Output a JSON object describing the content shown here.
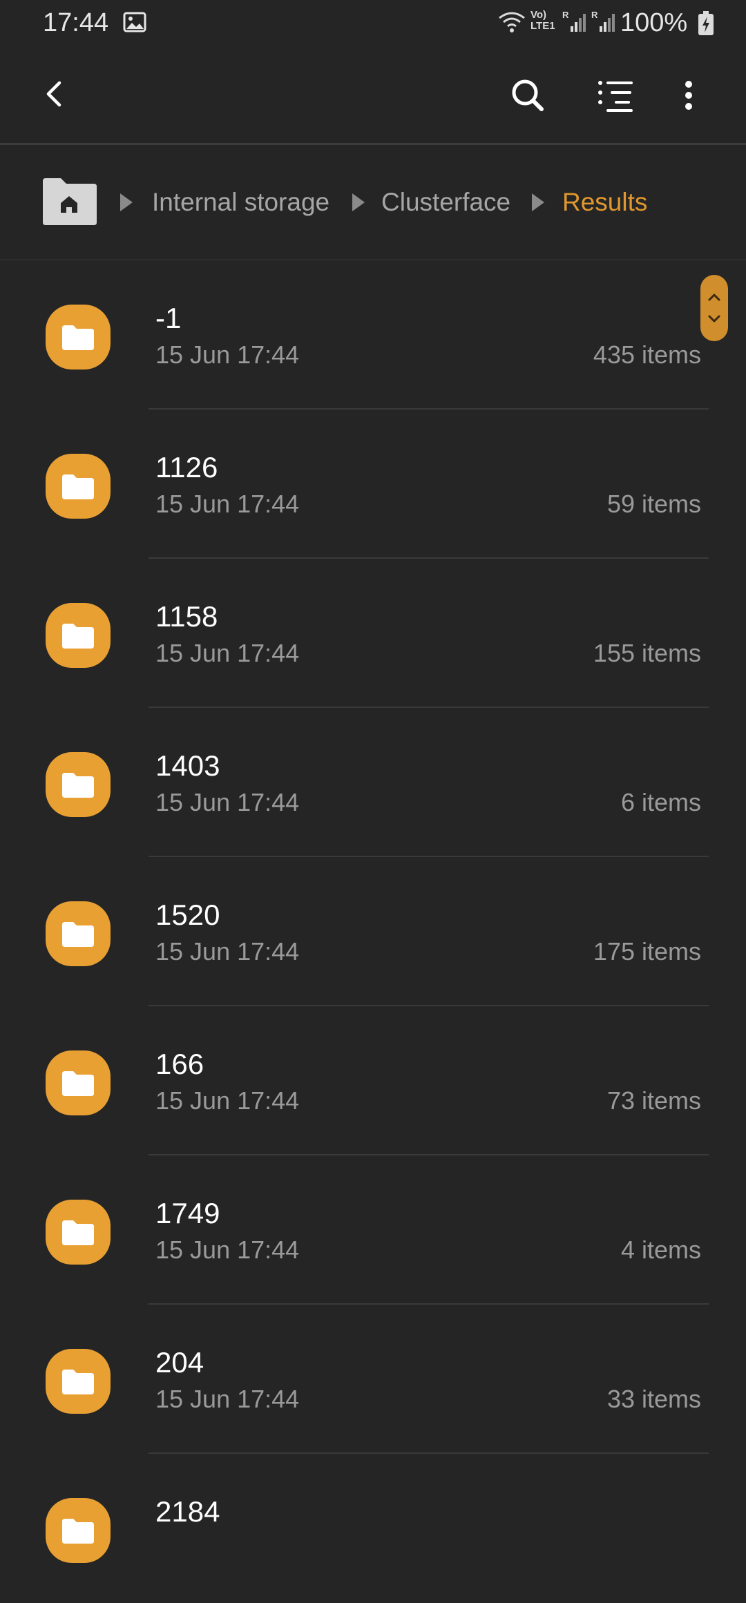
{
  "status_bar": {
    "time": "17:44",
    "volte_label_1": "Vo)",
    "volte_label_2": "LTE1",
    "signal_roaming_1": "R",
    "signal_roaming_2": "R",
    "battery_percent": "100%",
    "icons": [
      "gallery-icon",
      "wifi-icon",
      "signal-icon",
      "battery-charging-icon"
    ]
  },
  "app_bar": {
    "icons": [
      "back-icon",
      "search-icon",
      "sort-icon",
      "more-icon"
    ]
  },
  "breadcrumb": {
    "home_icon": "home-folder-icon",
    "items": [
      {
        "label": "Internal storage"
      },
      {
        "label": "Clusterface"
      },
      {
        "label": "Results"
      }
    ]
  },
  "colors": {
    "background": "#252525",
    "accent": "#e0972f",
    "folder": "#e9a033",
    "secondary_text": "#9a9a9a"
  },
  "folders": [
    {
      "name": "-1",
      "date": "15 Jun 17:44",
      "count": "435 items"
    },
    {
      "name": "1126",
      "date": "15 Jun 17:44",
      "count": "59 items"
    },
    {
      "name": "1158",
      "date": "15 Jun 17:44",
      "count": "155 items"
    },
    {
      "name": "1403",
      "date": "15 Jun 17:44",
      "count": "6 items"
    },
    {
      "name": "1520",
      "date": "15 Jun 17:44",
      "count": "175 items"
    },
    {
      "name": "166",
      "date": "15 Jun 17:44",
      "count": "73 items"
    },
    {
      "name": "1749",
      "date": "15 Jun 17:44",
      "count": "4 items"
    },
    {
      "name": "204",
      "date": "15 Jun 17:44",
      "count": "33 items"
    },
    {
      "name": "2184",
      "date": "",
      "count": ""
    }
  ]
}
